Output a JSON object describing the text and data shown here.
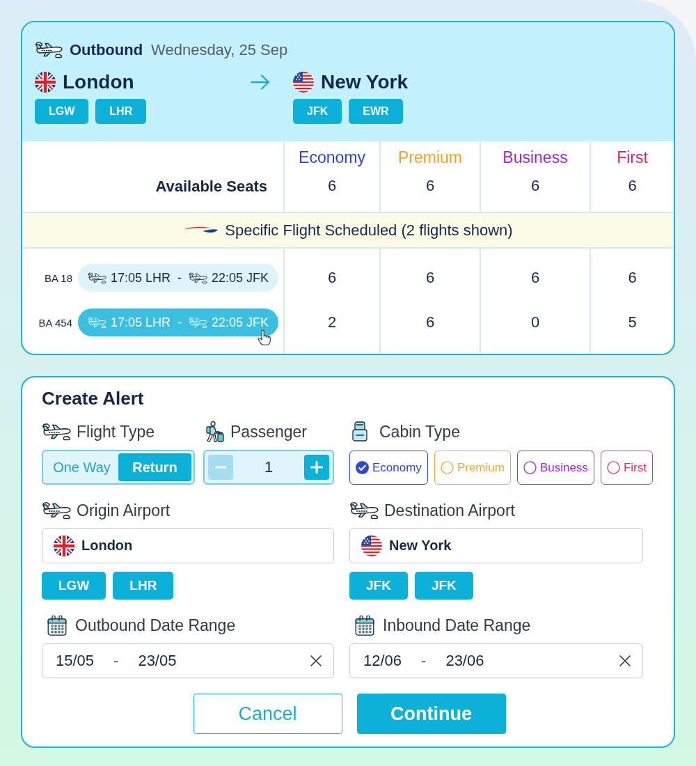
{
  "outbound": {
    "label": "Outbound",
    "date": "Wednesday, 25 Sep",
    "origin": {
      "city": "London",
      "airports": [
        "LGW",
        "LHR"
      ]
    },
    "destination": {
      "city": "New York",
      "airports": [
        "JFK",
        "EWR"
      ]
    }
  },
  "availability": {
    "row_label": "Available Seats",
    "classes": [
      {
        "name": "Economy",
        "color": "#2c3fe3",
        "seats": "6"
      },
      {
        "name": "Premium",
        "color": "#f5a11e",
        "seats": "6"
      },
      {
        "name": "Business",
        "color": "#a61fe0",
        "seats": "6"
      },
      {
        "name": "First",
        "color": "#e21f6b",
        "seats": "6"
      }
    ]
  },
  "banner": "Specific Flight Scheduled (2 flights shown)",
  "flights": [
    {
      "number": "BA 18",
      "departure": "17:05 LHR",
      "separator": "-",
      "arrival": "22:05 JFK",
      "selected": false,
      "seats": [
        "6",
        "6",
        "6",
        "6"
      ]
    },
    {
      "number": "BA 454",
      "departure": "17:05 LHR",
      "separator": "-",
      "arrival": "22:05 JFK",
      "selected": true,
      "seats": [
        "2",
        "6",
        "0",
        "5"
      ]
    }
  ],
  "alert": {
    "title": "Create Alert",
    "flight_type": {
      "label": "Flight Type",
      "options": [
        {
          "label": "One Way",
          "selected": false
        },
        {
          "label": "Return",
          "selected": true
        }
      ]
    },
    "passenger": {
      "label": "Passenger",
      "value": "1",
      "decrease_disabled": true
    },
    "cabin_type": {
      "label": "Cabin Type",
      "options": [
        {
          "label": "Economy",
          "color": "#2f46d4",
          "selected": true
        },
        {
          "label": "Premium",
          "color": "#f4a531",
          "selected": false
        },
        {
          "label": "Business",
          "color": "#a324d8",
          "selected": false
        },
        {
          "label": "First",
          "color": "#e2306e",
          "selected": false
        }
      ]
    },
    "origin_airport": {
      "label": "Origin Airport",
      "value": "London",
      "airports": [
        "LGW",
        "LHR"
      ]
    },
    "destination_airport": {
      "label": "Destination Airport",
      "value": "New York",
      "airports": [
        "JFK",
        "JFK"
      ]
    },
    "outbound_dates": {
      "label": "Outbound Date Range",
      "from": "15/05",
      "separator": "-",
      "to": "23/05"
    },
    "inbound_dates": {
      "label": "Inbound Date Range",
      "from": "12/06",
      "separator": "-",
      "to": "23/06"
    },
    "buttons": [
      {
        "label": "Cancel",
        "kind": "secondary"
      },
      {
        "label": "Continue",
        "kind": "primary"
      }
    ]
  }
}
